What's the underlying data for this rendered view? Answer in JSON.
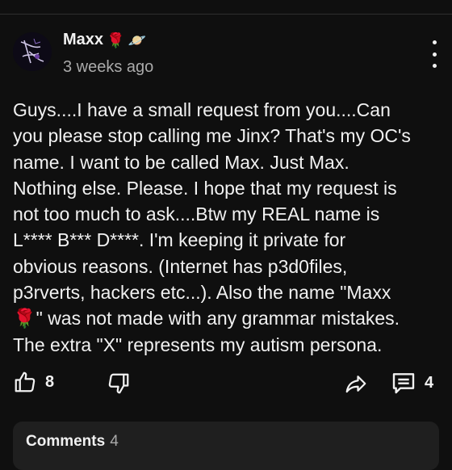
{
  "post": {
    "author": "Maxx",
    "author_emojis": [
      "🌹",
      "🪐"
    ],
    "time": "3 weeks ago",
    "text": "Guys....I have a small request from you....Can\nyou please stop calling me Jinx? That's my OC's\nname. I want to be called Max. Just Max.\nNothing else. Please. I hope that my request is\nnot too much to ask....Btw my REAL name is\nL**** B*** D****. I'm keeping it private for\nobvious reasons. (Internet has p3d0files,\np3rverts, hackers etc...). Also the name \"Maxx\n🌹\" was not made with any grammar mistakes.\nThe extra \"X\" represents my autism persona."
  },
  "actions": {
    "like_count": "8",
    "comment_count": "4"
  },
  "comments": {
    "label": "Comments",
    "count": "4"
  },
  "icons": {
    "like": "thumbs-up-icon",
    "dislike": "thumbs-down-icon",
    "share": "share-icon",
    "comment": "comment-icon",
    "more": "more-vertical-icon"
  },
  "colors": {
    "background": "#0f0f0f",
    "text": "#f1f1f1",
    "muted": "#aaaaaa",
    "card": "#1f1f1f"
  }
}
